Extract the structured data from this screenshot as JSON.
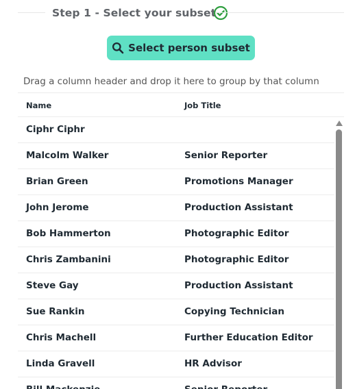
{
  "step": {
    "title": "Step 1 - Select your subset",
    "icon": "check-circle-icon",
    "icon_color": "#2e9e3e"
  },
  "select_button": {
    "label": "Select person subset",
    "icon": "search-icon",
    "color": "#5fe0c4"
  },
  "group_panel": {
    "text": "Drag a column header and drop it here to group by that column"
  },
  "grid": {
    "columns": [
      "Name",
      "Job Title"
    ],
    "rows": [
      {
        "name": "Ciphr Ciphr",
        "job": ""
      },
      {
        "name": "Malcolm Walker",
        "job": "Senior Reporter"
      },
      {
        "name": "Brian Green",
        "job": "Promotions Manager"
      },
      {
        "name": "John Jerome",
        "job": "Production Assistant"
      },
      {
        "name": "Bob Hammerton",
        "job": "Photographic Editor"
      },
      {
        "name": "Chris Zambanini",
        "job": "Photographic Editor"
      },
      {
        "name": "Steve Gay",
        "job": "Production Assistant"
      },
      {
        "name": "Sue Rankin",
        "job": "Copying Technician"
      },
      {
        "name": "Chris Machell",
        "job": "Further Education Editor"
      },
      {
        "name": "Linda Gravell",
        "job": "HR Advisor"
      },
      {
        "name": "Bill Mackenzie",
        "job": "Senior Reporter"
      }
    ]
  }
}
